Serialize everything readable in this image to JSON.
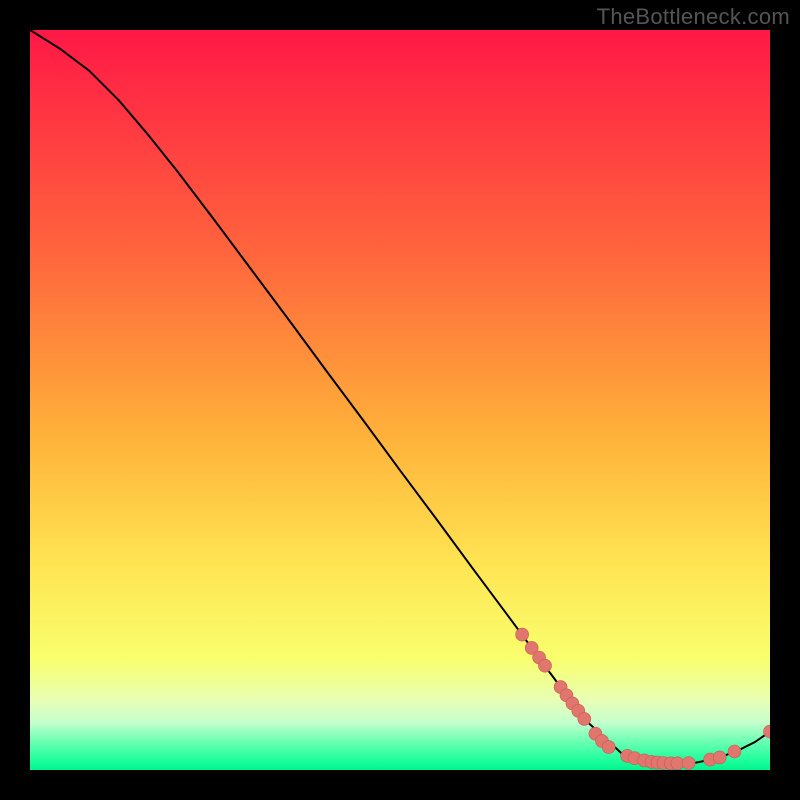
{
  "watermark": "TheBottleneck.com",
  "chart_data": {
    "type": "line",
    "title": "",
    "xlabel": "",
    "ylabel": "",
    "xlim": [
      0,
      100
    ],
    "ylim": [
      0,
      100
    ],
    "gradient_stops": [
      {
        "offset": 0,
        "color": "#ff1846"
      },
      {
        "offset": 0.32,
        "color": "#ff6a3c"
      },
      {
        "offset": 0.55,
        "color": "#ffb23a"
      },
      {
        "offset": 0.72,
        "color": "#ffe452"
      },
      {
        "offset": 0.85,
        "color": "#f9ff6d"
      },
      {
        "offset": 0.905,
        "color": "#e8ffb3"
      },
      {
        "offset": 0.935,
        "color": "#c7ffcf"
      },
      {
        "offset": 0.96,
        "color": "#70ffb4"
      },
      {
        "offset": 0.985,
        "color": "#23ff9e"
      },
      {
        "offset": 1.0,
        "color": "#00f58e"
      }
    ],
    "curve": [
      {
        "x": 0,
        "y": 100
      },
      {
        "x": 4,
        "y": 97.5
      },
      {
        "x": 8,
        "y": 94.5
      },
      {
        "x": 12,
        "y": 90.5
      },
      {
        "x": 16,
        "y": 85.8
      },
      {
        "x": 20,
        "y": 80.8
      },
      {
        "x": 25,
        "y": 74.2
      },
      {
        "x": 30,
        "y": 67.5
      },
      {
        "x": 35,
        "y": 60.8
      },
      {
        "x": 40,
        "y": 54.0
      },
      {
        "x": 45,
        "y": 47.3
      },
      {
        "x": 50,
        "y": 40.5
      },
      {
        "x": 55,
        "y": 33.8
      },
      {
        "x": 60,
        "y": 27.0
      },
      {
        "x": 65,
        "y": 20.3
      },
      {
        "x": 70,
        "y": 13.5
      },
      {
        "x": 75,
        "y": 6.8
      },
      {
        "x": 80,
        "y": 2.2
      },
      {
        "x": 83,
        "y": 1.2
      },
      {
        "x": 86,
        "y": 0.9
      },
      {
        "x": 90,
        "y": 1.0
      },
      {
        "x": 93,
        "y": 1.6
      },
      {
        "x": 96,
        "y": 2.8
      },
      {
        "x": 98,
        "y": 3.8
      },
      {
        "x": 100,
        "y": 5.2
      }
    ],
    "markers": [
      {
        "x": 66.5,
        "y": 18.3
      },
      {
        "x": 67.8,
        "y": 16.5
      },
      {
        "x": 68.8,
        "y": 15.2
      },
      {
        "x": 69.6,
        "y": 14.1
      },
      {
        "x": 71.7,
        "y": 11.2
      },
      {
        "x": 72.5,
        "y": 10.1
      },
      {
        "x": 73.3,
        "y": 9.0
      },
      {
        "x": 74.1,
        "y": 8.0
      },
      {
        "x": 74.9,
        "y": 6.9
      },
      {
        "x": 76.4,
        "y": 4.9
      },
      {
        "x": 77.3,
        "y": 3.9
      },
      {
        "x": 78.2,
        "y": 3.1
      },
      {
        "x": 80.7,
        "y": 1.9
      },
      {
        "x": 81.7,
        "y": 1.6
      },
      {
        "x": 83.0,
        "y": 1.3
      },
      {
        "x": 84.0,
        "y": 1.1
      },
      {
        "x": 84.8,
        "y": 1.0
      },
      {
        "x": 85.6,
        "y": 0.95
      },
      {
        "x": 86.6,
        "y": 0.9
      },
      {
        "x": 87.5,
        "y": 0.9
      },
      {
        "x": 89.0,
        "y": 0.95
      },
      {
        "x": 91.9,
        "y": 1.4
      },
      {
        "x": 93.2,
        "y": 1.7
      },
      {
        "x": 95.2,
        "y": 2.5
      },
      {
        "x": 100,
        "y": 5.2
      }
    ]
  }
}
